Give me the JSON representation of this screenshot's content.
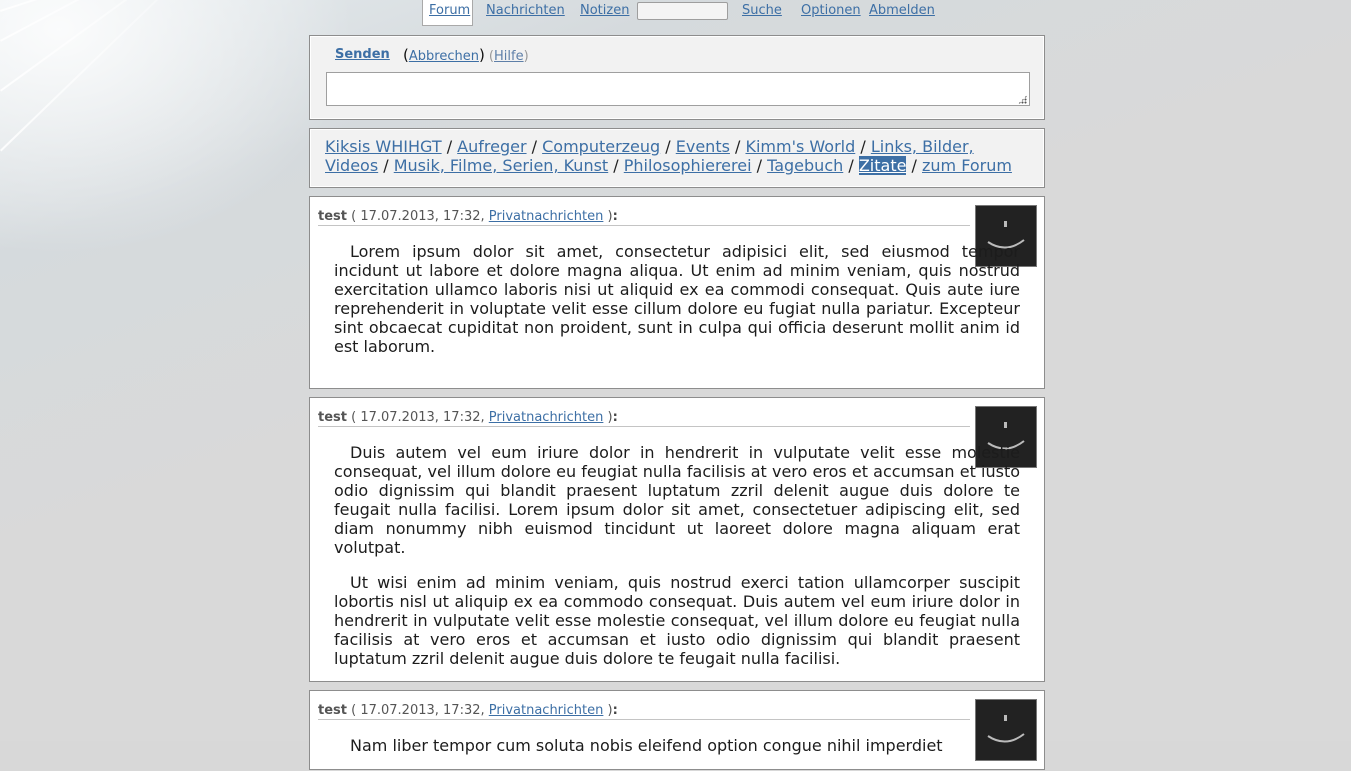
{
  "nav": {
    "forum": "Forum",
    "messages": "Nachrichten",
    "notes": "Notizen",
    "search_value": "",
    "search": "Suche",
    "options": "Optionen",
    "logout": "Abmelden"
  },
  "compose": {
    "send": "Senden",
    "cancel": "Abbrechen",
    "help": "Hilfe",
    "text": ""
  },
  "categories": [
    "Kiksis WHIHGT",
    "Aufreger",
    "Computerzeug",
    "Events",
    "Kimm's World",
    "Links, Bilder, Videos",
    "Musik, Filme, Serien, Kunst",
    "Philosophiererei",
    "Tagebuch",
    "Zitate",
    "zum Forum"
  ],
  "posts": [
    {
      "author": "test",
      "date": "17.07.2013, 17:32,",
      "link": "Privatnachrichten",
      "paragraphs": [
        "Lorem ipsum dolor sit amet, consectetur adipisici elit, sed eiusmod tempor incidunt ut labore et dolore magna aliqua. Ut enim ad minim veniam, quis nostrud exercitation ullamco laboris nisi ut aliquid ex ea commodi consequat. Quis aute iure reprehenderit in voluptate velit esse cillum dolore eu fugiat nulla pariatur. Excepteur sint obcaecat cupiditat non proident, sunt in culpa qui officia deserunt mollit anim id est laborum."
      ]
    },
    {
      "author": "test",
      "date": "17.07.2013, 17:32,",
      "link": "Privatnachrichten",
      "paragraphs": [
        "Duis autem vel eum iriure dolor in hendrerit in vulputate velit esse molestie consequat, vel illum dolore eu feugiat nulla facilisis at vero eros et accumsan et iusto odio dignissim qui blandit praesent luptatum zzril delenit augue duis dolore te feugait nulla facilisi. Lorem ipsum dolor sit amet, consectetuer adipiscing elit, sed diam nonummy nibh euismod tincidunt ut laoreet dolore magna aliquam erat volutpat.",
        "Ut wisi enim ad minim veniam, quis nostrud exerci tation ullamcorper suscipit lobortis nisl ut aliquip ex ea commodo consequat. Duis autem vel eum iriure dolor in hendrerit in vulputate velit esse molestie consequat, vel illum dolore eu feugiat nulla facilisis at vero eros et accumsan et iusto odio dignissim qui blandit praesent luptatum zzril delenit augue duis dolore te feugait nulla facilisi."
      ]
    },
    {
      "author": "test",
      "date": "17.07.2013, 17:32,",
      "link": "Privatnachrichten",
      "paragraphs": [
        "Nam liber tempor cum soluta nobis eleifend option congue nihil imperdiet"
      ]
    }
  ]
}
